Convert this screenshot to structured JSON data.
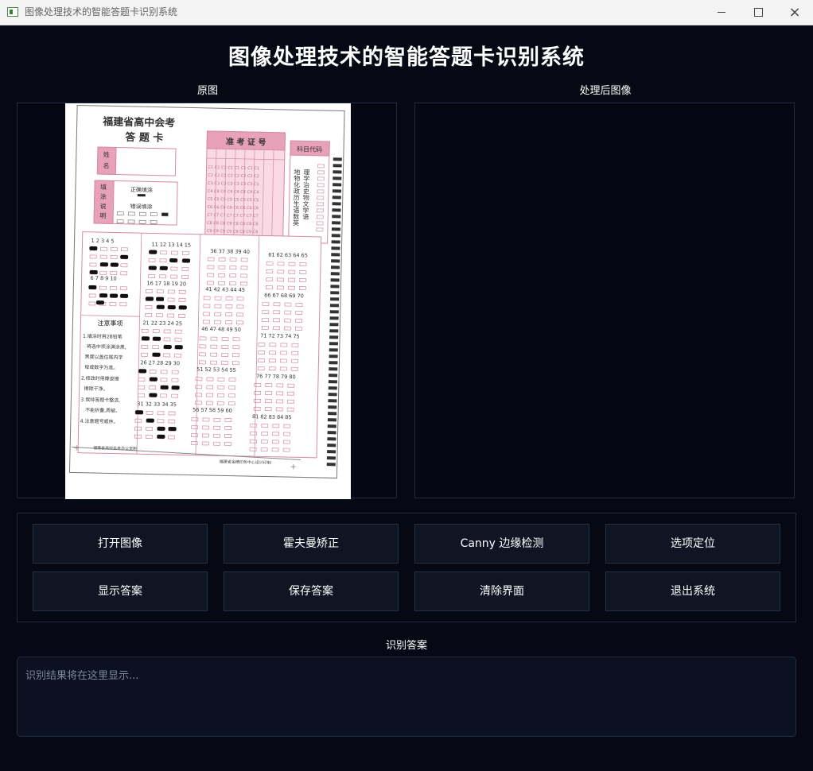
{
  "window": {
    "title": "图像处理技术的智能答题卡识别系统",
    "controls": {
      "minimize": "minimize-icon",
      "maximize": "maximize-icon",
      "close": "close-icon"
    }
  },
  "header": {
    "title": "图像处理技术的智能答题卡识别系统"
  },
  "panes": {
    "original_label": "原图",
    "processed_label": "处理后图像"
  },
  "buttons": {
    "open": "打开图像",
    "hough": "霍夫曼矫正",
    "canny": "Canny 边缘检测",
    "locate": "选项定位",
    "show": "显示答案",
    "save": "保存答案",
    "clear": "清除界面",
    "exit": "退出系统"
  },
  "answers": {
    "label": "识别答案",
    "placeholder": "识别结果将在这里显示..."
  },
  "sheet": {
    "title_line1": "福建省高中会考",
    "title_line2": "答 题 卡",
    "name_label_1": "姓",
    "name_label_2": "名",
    "ticket_label": "准 考 证 号",
    "subject_code_label": "科目代码",
    "fill_label_1": "填",
    "fill_label_2": "涂",
    "fill_label_3": "说",
    "fill_label_4": "明",
    "correct_fill": "正确填涂",
    "wrong_fill": "错误填涂",
    "notes_title": "注意事项",
    "note1": "1.填涂时用2B铅笔",
    "note2": "将选中项涂满涂黑,",
    "note3": "黑度以盖住框内字",
    "note4": "母或数字为准。",
    "note5": "2.修改时用橡皮擦",
    "note6": "擦除干净。",
    "note7": "3.保持答题卡整洁,",
    "note8": "不能折叠,弄破。",
    "note9": "4.注意题号顺序。",
    "footer_left": "福建省高中会考办公室制",
    "footer_right": "福建省金穗印务中心设计印制",
    "subjects_col1": "地物化政历生语数英",
    "subjects_col2": "理学治史物文学语",
    "block_numbers": [
      "1 2 3 4 5",
      "6 7 8 9 10",
      "11 12 13 14 15",
      "16 17 18 19 20",
      "21 22 23 24 25",
      "26 27 28 29 30",
      "31 32 33 34 35",
      "36 37 38 39 40",
      "41 42 43 44 45",
      "46 47 48 49 50",
      "51 52 53 54 55",
      "56 57 58 59 60",
      "61 62 63 64 65",
      "66 67 68 69 70",
      "71 72 73 74 75",
      "76 77 78 79 80",
      "81 82 83 84 85"
    ]
  },
  "colors": {
    "background": "#060914",
    "button": "#0f1523",
    "accent_pink": "#e7a1b8",
    "sheet_line": "#d58aa4"
  }
}
